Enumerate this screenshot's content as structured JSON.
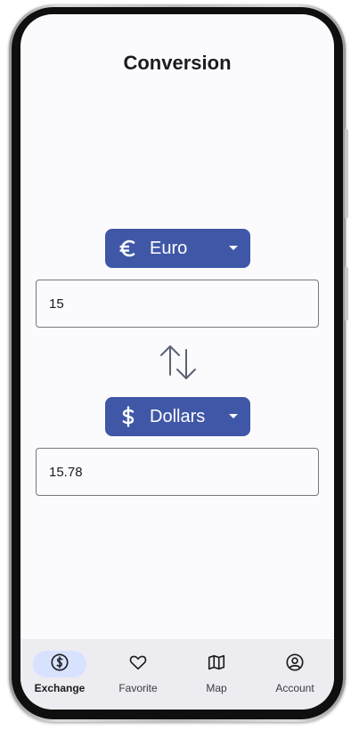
{
  "header": {
    "title": "Conversion"
  },
  "from": {
    "currency_label": "Euro",
    "icon": "euro-icon",
    "amount": "15"
  },
  "to": {
    "currency_label": "Dollars",
    "icon": "dollar-icon",
    "amount": "15.78"
  },
  "nav": {
    "items": [
      {
        "label": "Exchange",
        "icon": "dollar-circle-icon",
        "active": true
      },
      {
        "label": "Favorite",
        "icon": "heart-icon",
        "active": false
      },
      {
        "label": "Map",
        "icon": "map-icon",
        "active": false
      },
      {
        "label": "Account",
        "icon": "account-circle-icon",
        "active": false
      }
    ]
  },
  "colors": {
    "accent": "#3f57a6",
    "nav_active_pill": "#d8e2ff",
    "screen_bg": "#fbfbfe"
  }
}
